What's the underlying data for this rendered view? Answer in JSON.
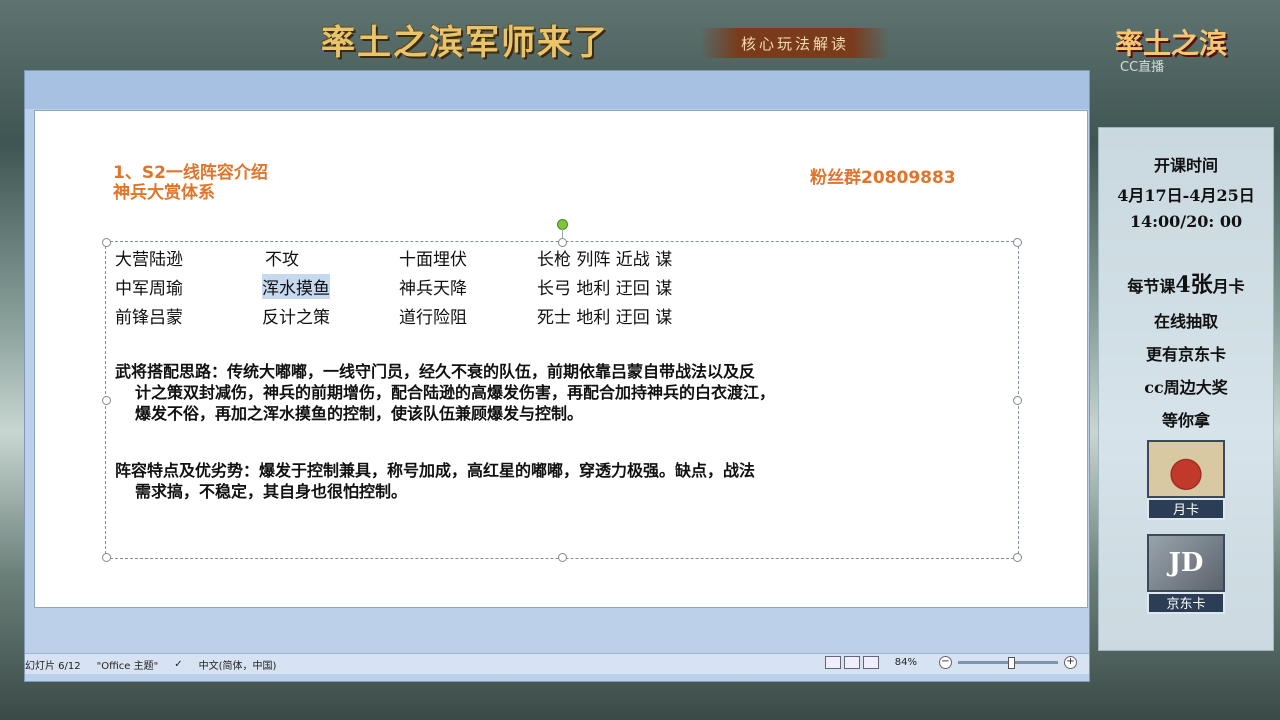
{
  "header": {
    "banner_title": "率土之滨军师来了",
    "subtitle": "核心玩法解读",
    "corner_logo": "率土之滨",
    "watermark": "CC直播"
  },
  "slide": {
    "title_line1": "1、S2一线阵容介绍",
    "title_line2": "神兵大赏体系",
    "fan_group": "粉丝群20809883",
    "roster": [
      {
        "general": "大营陆逊",
        "tactic": "不攻",
        "skill": "十面埋伏",
        "traits": "长枪  列阵  近战  谋"
      },
      {
        "general": "中军周瑜",
        "tactic": "浑水摸鱼",
        "skill": "神兵天降",
        "traits": "长弓  地利  迂回  谋"
      },
      {
        "general": "前锋吕蒙",
        "tactic": "反计之策",
        "skill": "道行险阻",
        "traits": "死士  地利  迂回  谋"
      }
    ],
    "strategy_p1": "武将搭配思路：传统大嘟嘟，一线守门员，经久不衰的队伍，前期依靠吕蒙自带战法以及反",
    "strategy_p2": "计之策双封减伤，神兵的前期增伤，配合陆逊的高爆发伤害，再配合加持神兵的白衣渡江，",
    "strategy_p3": "爆发不俗，再加之浑水摸鱼的控制，使该队伍兼顾爆发与控制。",
    "features_p1": "阵容特点及优劣势：爆发于控制兼具，称号加成，高红星的嘟嘟，穿透力极强。缺点，战法",
    "features_p2": "需求搞，不稳定，其自身也很怕控制。"
  },
  "statusbar": {
    "slide_count": "幻灯片 6/12",
    "theme": "\"Office 主题\"",
    "language": "中文(简体，中国)",
    "zoom": "84%"
  },
  "side_panel": {
    "schedule_title": "开课时间",
    "schedule_dates": "4月17日-4月25日",
    "schedule_time": "14:00/20: 00",
    "promo_line1_pre": "每节课",
    "promo_line1_num": "4张",
    "promo_line1_post": "月卡",
    "promo_line2": "在线抽取",
    "promo_line3": "更有京东卡",
    "promo_line4": "cc周边大奖",
    "promo_line5": "等你拿",
    "card1_label": "月卡",
    "card2_label": "京东卡",
    "card2_glyph": "JD"
  }
}
